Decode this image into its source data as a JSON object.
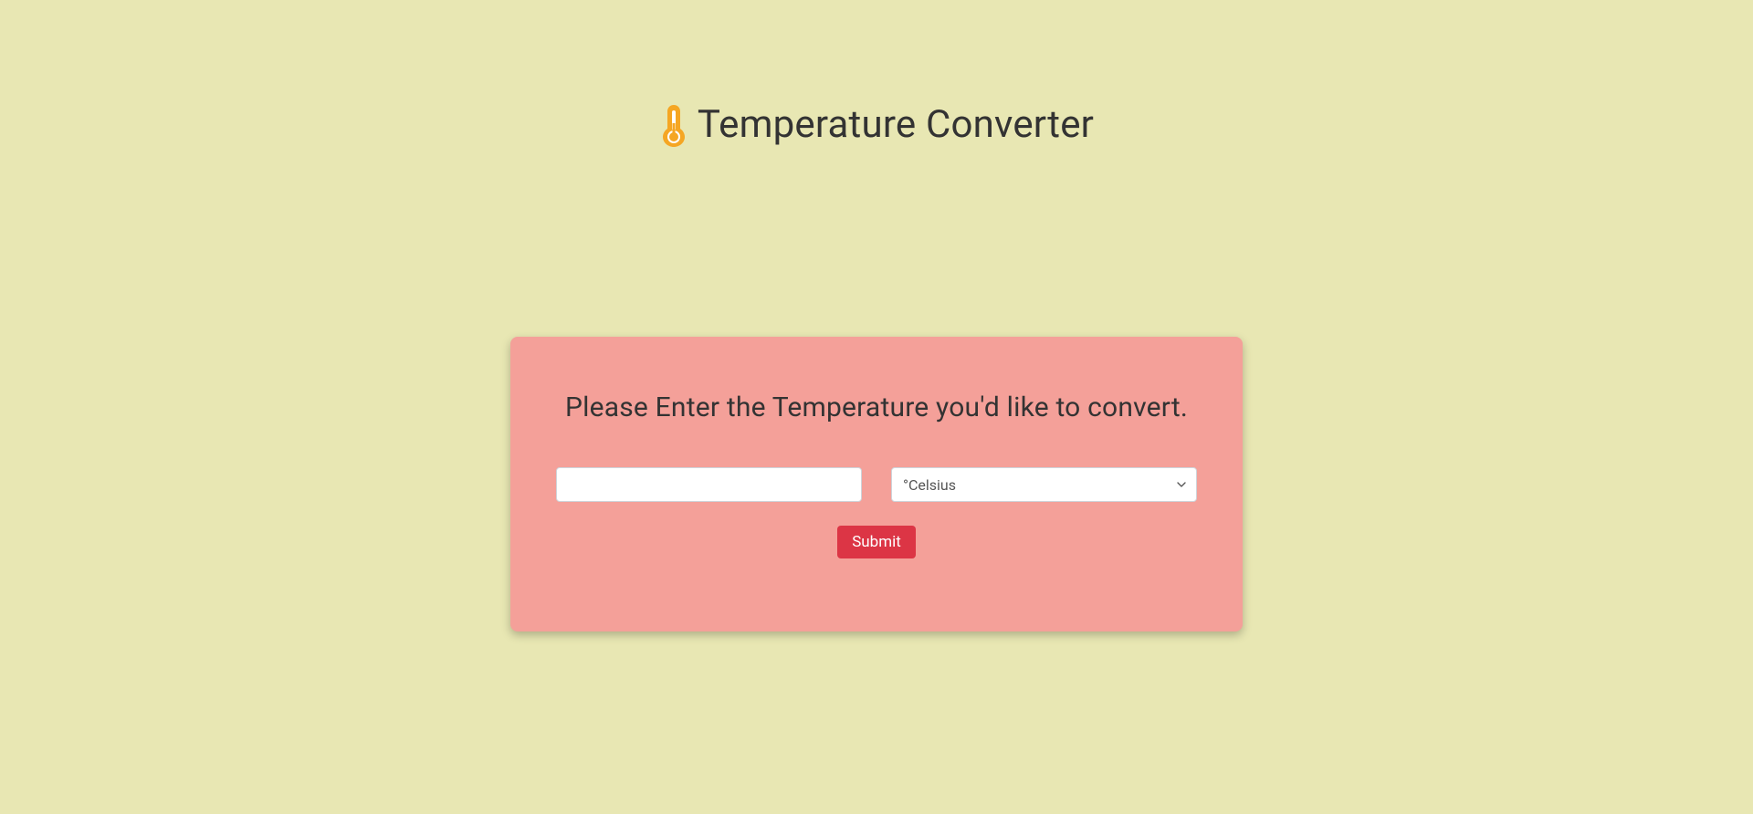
{
  "header": {
    "title": "Temperature Converter",
    "icon_name": "thermometer-icon"
  },
  "card": {
    "instruction": "Please Enter the Temperature you'd like to convert.",
    "input_value": "",
    "select_selected": "°Celsius",
    "submit_label": "Submit"
  },
  "colors": {
    "background": "#e8e7b3",
    "card_background": "#f4a099",
    "submit_button": "#dc3545",
    "icon_color": "#f5a623"
  }
}
